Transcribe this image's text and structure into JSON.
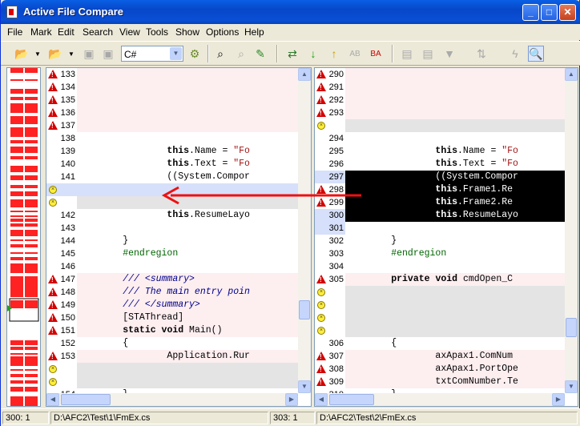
{
  "window": {
    "title": "Active File Compare"
  },
  "menu": [
    "File",
    "Mark",
    "Edit",
    "Search",
    "View",
    "Tools",
    "Show",
    "Options",
    "Help"
  ],
  "toolbar": {
    "language": "C#"
  },
  "colors": {
    "pink": "#fdeef0",
    "gray": "#e4e4e4",
    "selected": "#d6e0fa",
    "black": "#000000",
    "red": "#ff0000"
  },
  "left": {
    "rows": [
      {
        "ln": "133",
        "ic": "warn",
        "bg": "pink",
        "code": ""
      },
      {
        "ln": "134",
        "ic": "warn",
        "bg": "pink",
        "code": ""
      },
      {
        "ln": "135",
        "ic": "warn",
        "bg": "pink",
        "code": ""
      },
      {
        "ln": "136",
        "ic": "warn",
        "bg": "pink",
        "code": ""
      },
      {
        "ln": "137",
        "ic": "warn",
        "bg": "pink",
        "code": ""
      },
      {
        "ln": "138",
        "ic": "",
        "bg": "",
        "code": ""
      },
      {
        "ln": "139",
        "ic": "",
        "bg": "",
        "code": "                this.Name = \"Fo"
      },
      {
        "ln": "140",
        "ic": "",
        "bg": "",
        "code": "                this.Text = \"Fo"
      },
      {
        "ln": "141",
        "ic": "",
        "bg": "",
        "code": "                ((System.Compor"
      },
      {
        "ln": "",
        "ic": "circ",
        "bg": "sel",
        "code": ""
      },
      {
        "ln": "",
        "ic": "circ",
        "bg": "gray",
        "code": ""
      },
      {
        "ln": "142",
        "ic": "",
        "bg": "",
        "code": "                this.ResumeLayo"
      },
      {
        "ln": "143",
        "ic": "",
        "bg": "",
        "code": ""
      },
      {
        "ln": "144",
        "ic": "",
        "bg": "",
        "code": "        }"
      },
      {
        "ln": "145",
        "ic": "",
        "bg": "",
        "code": "        #endregion"
      },
      {
        "ln": "146",
        "ic": "",
        "bg": "",
        "code": ""
      },
      {
        "ln": "147",
        "ic": "warn",
        "bg": "pink",
        "code": "        /// <summary>"
      },
      {
        "ln": "148",
        "ic": "warn",
        "bg": "pink",
        "code": "        /// The main entry poin"
      },
      {
        "ln": "149",
        "ic": "warn",
        "bg": "pink",
        "code": "        /// </summary>"
      },
      {
        "ln": "150",
        "ic": "warn",
        "bg": "pink",
        "code": "        [STAThread]"
      },
      {
        "ln": "151",
        "ic": "warn",
        "bg": "pink",
        "code": "        static void Main()"
      },
      {
        "ln": "152",
        "ic": "",
        "bg": "",
        "code": "        {"
      },
      {
        "ln": "153",
        "ic": "warn",
        "bg": "pink",
        "code": "                Application.Rur"
      },
      {
        "ln": "",
        "ic": "circ",
        "bg": "gray",
        "code": ""
      },
      {
        "ln": "",
        "ic": "circ",
        "bg": "gray",
        "code": ""
      },
      {
        "ln": "154",
        "ic": "",
        "bg": "",
        "code": "        }"
      }
    ]
  },
  "right": {
    "rows": [
      {
        "ln": "290",
        "ic": "warn",
        "bg": "pink",
        "code": ""
      },
      {
        "ln": "291",
        "ic": "warn",
        "bg": "pink",
        "code": ""
      },
      {
        "ln": "292",
        "ic": "warn",
        "bg": "pink",
        "code": ""
      },
      {
        "ln": "293",
        "ic": "warn",
        "bg": "pink",
        "code": ""
      },
      {
        "ln": "",
        "ic": "circ",
        "bg": "gray",
        "code": ""
      },
      {
        "ln": "294",
        "ic": "",
        "bg": "",
        "code": ""
      },
      {
        "ln": "295",
        "ic": "",
        "bg": "",
        "code": "                this.Name = \"Fo"
      },
      {
        "ln": "296",
        "ic": "",
        "bg": "",
        "code": "                this.Text = \"Fo"
      },
      {
        "ln": "297",
        "ic": "",
        "bg": "black",
        "code": "                ((System.Compor",
        "lnbg": "sel"
      },
      {
        "ln": "298",
        "ic": "warn",
        "bg": "black",
        "code": "                this.Frame1.Re"
      },
      {
        "ln": "299",
        "ic": "warn",
        "bg": "black",
        "code": "                this.Frame2.Re"
      },
      {
        "ln": "300",
        "ic": "",
        "bg": "black",
        "code": "                this.ResumeLayo",
        "lnbg": "sel"
      },
      {
        "ln": "301",
        "ic": "",
        "bg": "",
        "code": "",
        "lnbg": "sel"
      },
      {
        "ln": "302",
        "ic": "",
        "bg": "",
        "code": "        }"
      },
      {
        "ln": "303",
        "ic": "",
        "bg": "",
        "code": "        #endregion"
      },
      {
        "ln": "304",
        "ic": "",
        "bg": "",
        "code": ""
      },
      {
        "ln": "305",
        "ic": "warn",
        "bg": "pink",
        "code": "        private void cmdOpen_C"
      },
      {
        "ln": "",
        "ic": "circ",
        "bg": "gray",
        "code": ""
      },
      {
        "ln": "",
        "ic": "circ",
        "bg": "gray",
        "code": ""
      },
      {
        "ln": "",
        "ic": "circ",
        "bg": "gray",
        "code": ""
      },
      {
        "ln": "",
        "ic": "circ",
        "bg": "gray",
        "code": ""
      },
      {
        "ln": "306",
        "ic": "",
        "bg": "",
        "code": "        {"
      },
      {
        "ln": "307",
        "ic": "warn",
        "bg": "pink",
        "code": "                axApax1.ComNum"
      },
      {
        "ln": "308",
        "ic": "warn",
        "bg": "pink",
        "code": "                axApax1.PortOpe"
      },
      {
        "ln": "309",
        "ic": "warn",
        "bg": "pink",
        "code": "                txtComNumber.Te"
      },
      {
        "ln": "310",
        "ic": "",
        "bg": "",
        "code": "        }"
      }
    ]
  },
  "status": {
    "left_pos": "300: 1",
    "left_path": "D:\\AFC2\\Test\\1\\FmEx.cs",
    "right_pos": "303: 1",
    "right_path": "D:\\AFC2\\Test\\2\\FmEx.cs"
  }
}
